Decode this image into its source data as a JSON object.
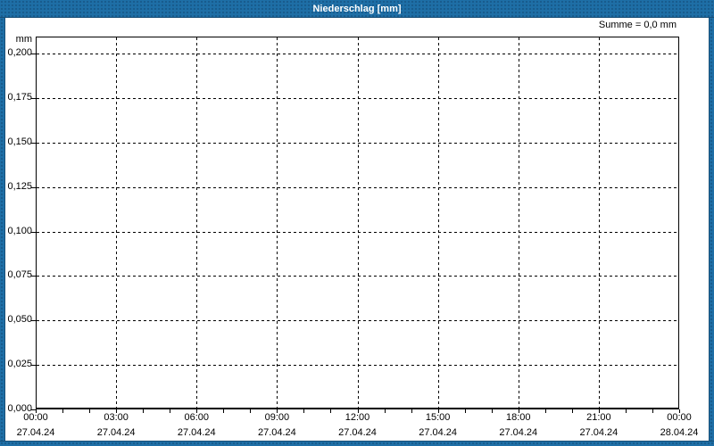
{
  "window": {
    "title": "Niederschlag [mm]"
  },
  "colors": {
    "frame_blue": "#1E6FA6",
    "frame_dark": "#174E76",
    "title_text": "#FFFFFF",
    "grid": "#000000"
  },
  "chart_data": {
    "type": "bar",
    "title": "Niederschlag [mm]",
    "summary": "Summe = 0,0 mm",
    "series": [
      {
        "name": "Niederschlag",
        "values": []
      }
    ],
    "x_axis": {
      "range_hours": 24,
      "major_tick_hours": 3,
      "minor_tick_hours": 1,
      "ticks": [
        {
          "time": "00:00",
          "date": "27.04.24"
        },
        {
          "time": "03:00",
          "date": "27.04.24"
        },
        {
          "time": "06:00",
          "date": "27.04.24"
        },
        {
          "time": "09:00",
          "date": "27.04.24"
        },
        {
          "time": "12:00",
          "date": "27.04.24"
        },
        {
          "time": "15:00",
          "date": "27.04.24"
        },
        {
          "time": "18:00",
          "date": "27.04.24"
        },
        {
          "time": "21:00",
          "date": "27.04.24"
        },
        {
          "time": "00:00",
          "date": "28.04.24"
        }
      ]
    },
    "y_axis": {
      "unit": "mm",
      "min": 0.0,
      "max": 0.2,
      "step": 0.025,
      "tick_labels": [
        "0,200",
        "0,175",
        "0,150",
        "0,125",
        "0,100",
        "0,075",
        "0,050",
        "0,025",
        "0,000"
      ]
    },
    "grid": true,
    "legend": false
  }
}
